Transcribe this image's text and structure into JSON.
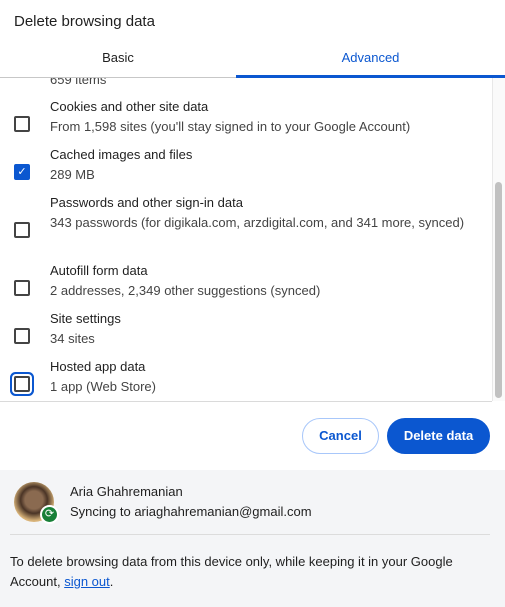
{
  "title": "Delete browsing data",
  "tabs": [
    {
      "label": "Basic",
      "active": false
    },
    {
      "label": "Advanced",
      "active": true
    }
  ],
  "partial_item": "659 items",
  "items": [
    {
      "title": "Cookies and other site data",
      "detail": "From 1,598 sites (you'll stay signed in to your Google Account)",
      "checked": false
    },
    {
      "title": "Cached images and files",
      "detail": "289 MB",
      "checked": true
    },
    {
      "title": "Passwords and other sign-in data",
      "detail": "343 passwords (for digikala.com, arzdigital.com, and 341 more, synced)",
      "checked": false
    },
    {
      "title": "Autofill form data",
      "detail": "2 addresses, 2,349 other suggestions (synced)",
      "checked": false
    },
    {
      "title": "Site settings",
      "detail": "34 sites",
      "checked": false
    },
    {
      "title": "Hosted app data",
      "detail": "1 app (Web Store)",
      "checked": false
    }
  ],
  "buttons": {
    "cancel": "Cancel",
    "delete": "Delete data"
  },
  "account": {
    "name": "Aria Ghahremanian",
    "sync": "Syncing to ariaghahremanian@gmail.com"
  },
  "note": {
    "prefix": "To delete browsing data from this device only, while keeping it in your Google Account, ",
    "link": "sign out",
    "suffix": "."
  },
  "colors": {
    "accent": "#0b57d0",
    "sync_badge": "#188038"
  }
}
